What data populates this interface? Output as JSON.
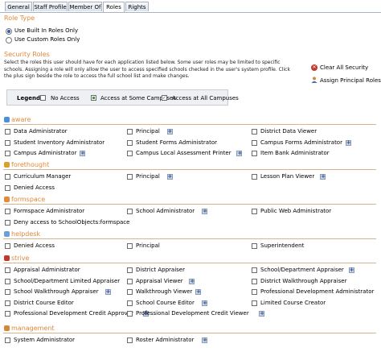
{
  "tabs": [
    "General",
    "Staff Profile",
    "Member Of",
    "Roles",
    "Rights"
  ],
  "active_tab": 3,
  "role_type": {
    "heading": "Role Type",
    "options": [
      "Use Built In Roles Only",
      "Use Custom Roles Only"
    ],
    "selected": 0
  },
  "security_roles": {
    "heading": "Security Roles",
    "description": "Select the roles this user should have for each application listed below. Some user roles may be limited to specific schools. Assigning a role will only allow the user to access specified schools checked in the user's system profile. Click the plus sign beside the role to access the full school list and make changes.",
    "clear_label": "Clear All Security",
    "assign_label": "Assign Principal Roles"
  },
  "legend": {
    "title": "Legend:",
    "items": [
      "No Access",
      "Access at Some Campuses",
      "Access at All Campuses"
    ]
  },
  "colors": {
    "accent": "#e2883a",
    "tab_border": "#a8b4c4",
    "plus": "#c9d4e6"
  },
  "sections": [
    {
      "name": "aware",
      "icon": "aware-icon",
      "rows": [
        [
          {
            "label": "Data Administrator",
            "plus": false
          },
          {
            "label": "Principal",
            "plus": true
          },
          {
            "label": "District Data Viewer",
            "plus": false
          }
        ],
        [
          {
            "label": "Student Inventory Administrator",
            "plus": false
          },
          {
            "label": "Student Forms Administrator",
            "plus": false
          },
          {
            "label": "Campus Forms Administrator",
            "plus": true
          }
        ],
        [
          {
            "label": "Campus Administrator",
            "plus": true
          },
          {
            "label": "Campus Local Assessment Printer",
            "plus": true
          },
          {
            "label": "Item Bank Administrator",
            "plus": false
          }
        ]
      ]
    },
    {
      "name": "forethought",
      "icon": "forethought-icon",
      "rows": [
        [
          {
            "label": "Curriculum Manager",
            "plus": false
          },
          {
            "label": "Principal",
            "plus": true
          },
          {
            "label": "Lesson Plan Viewer",
            "plus": true
          }
        ],
        [
          {
            "label": "Denied Access",
            "plus": false
          }
        ]
      ]
    },
    {
      "name": "formspace",
      "icon": "formspace-icon",
      "rows": [
        [
          {
            "label": "Formspace Administrator",
            "plus": false
          },
          {
            "label": "School Administrator",
            "plus": true
          },
          {
            "label": "Public Web Administrator",
            "plus": false
          }
        ],
        [
          {
            "label": "Deny access to SchoolObjects:formspace",
            "plus": false
          }
        ]
      ]
    },
    {
      "name": "helpdesk",
      "icon": "helpdesk-icon",
      "rows": [
        [
          {
            "label": "Denied Access",
            "plus": false
          },
          {
            "label": "Principal",
            "plus": false
          },
          {
            "label": "Superintendent",
            "plus": false
          }
        ]
      ]
    },
    {
      "name": "strive",
      "icon": "strive-icon",
      "rows": [
        [
          {
            "label": "Appraisal Administrator",
            "plus": false
          },
          {
            "label": "District Appraiser",
            "plus": false
          },
          {
            "label": "School/Department Appraiser",
            "plus": true
          }
        ],
        [
          {
            "label": "School/Department Limited Appraiser",
            "plus": true
          },
          {
            "label": "Appraisal Viewer",
            "plus": true
          },
          {
            "label": "District Walkthrough Appraiser",
            "plus": false
          }
        ],
        [
          {
            "label": "School Walkthrough Appraiser",
            "plus": true
          },
          {
            "label": "Walkthrough Viewer",
            "plus": true
          },
          {
            "label": "Professional Development Administrator",
            "plus": false
          }
        ],
        [
          {
            "label": "District Course Editor",
            "plus": false
          },
          {
            "label": "School Course Editor",
            "plus": true
          },
          {
            "label": "Limited Course Creator",
            "plus": false
          }
        ],
        [
          {
            "label": "Professional Development Credit Approver",
            "plus": true
          },
          {
            "label": "Professional Development Credit Viewer",
            "plus": true
          }
        ]
      ]
    },
    {
      "name": "management",
      "icon": "management-icon",
      "rows": [
        [
          {
            "label": "System Administrator",
            "plus": false
          },
          {
            "label": "Roster Administrator",
            "plus": true
          }
        ]
      ]
    }
  ]
}
